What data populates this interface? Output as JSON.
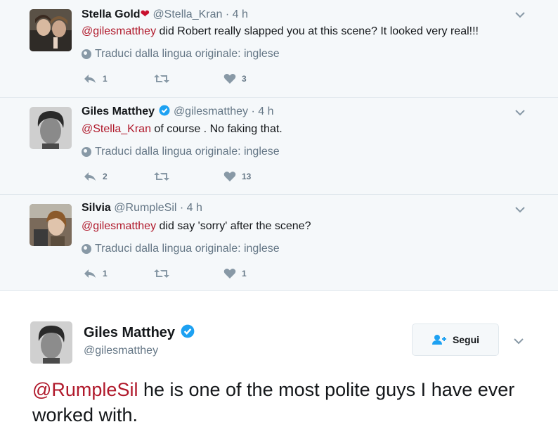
{
  "replies": [
    {
      "name": "Stella Gold",
      "name_emoji": "❤",
      "handle": "@Stella_Kran",
      "time": "4 h",
      "mention": "@gilesmatthey",
      "text": " did Robert really slapped you at this scene? It looked very real!!!",
      "translate": "Traduci dalla lingua originale: inglese",
      "reply_count": "1",
      "retweet_count": "",
      "like_count": "3"
    },
    {
      "name": "Giles Matthey",
      "handle": "@gilesmatthey",
      "time": "4 h",
      "mention": "@Stella_Kran",
      "text": " of course . No faking that.",
      "translate": "Traduci dalla lingua originale: inglese",
      "reply_count": "2",
      "retweet_count": "",
      "like_count": "13"
    },
    {
      "name": "Silvia",
      "handle": "@RumpleSil",
      "time": "4 h",
      "mention": "@gilesmatthey",
      "text": " did say 'sorry' after the scene?",
      "translate": "Traduci dalla lingua originale: inglese",
      "reply_count": "1",
      "retweet_count": "",
      "like_count": "1"
    }
  ],
  "main_tweet": {
    "name": "Giles Matthey",
    "handle": "@gilesmatthey",
    "follow_label": "Segui",
    "mention": "@RumpleSil",
    "text": " he is one of the most polite guys I have ever worked with."
  },
  "colors": {
    "mention": "#b0192b",
    "verified": "#1da1f2",
    "heart": "#c8102e",
    "secondary_text": "#657786",
    "reply_bg": "#f5f8fa"
  },
  "icons": [
    "reply-icon",
    "retweet-icon",
    "heart-icon",
    "globe-icon",
    "verified-icon",
    "chevron-down-icon",
    "follow-icon"
  ]
}
